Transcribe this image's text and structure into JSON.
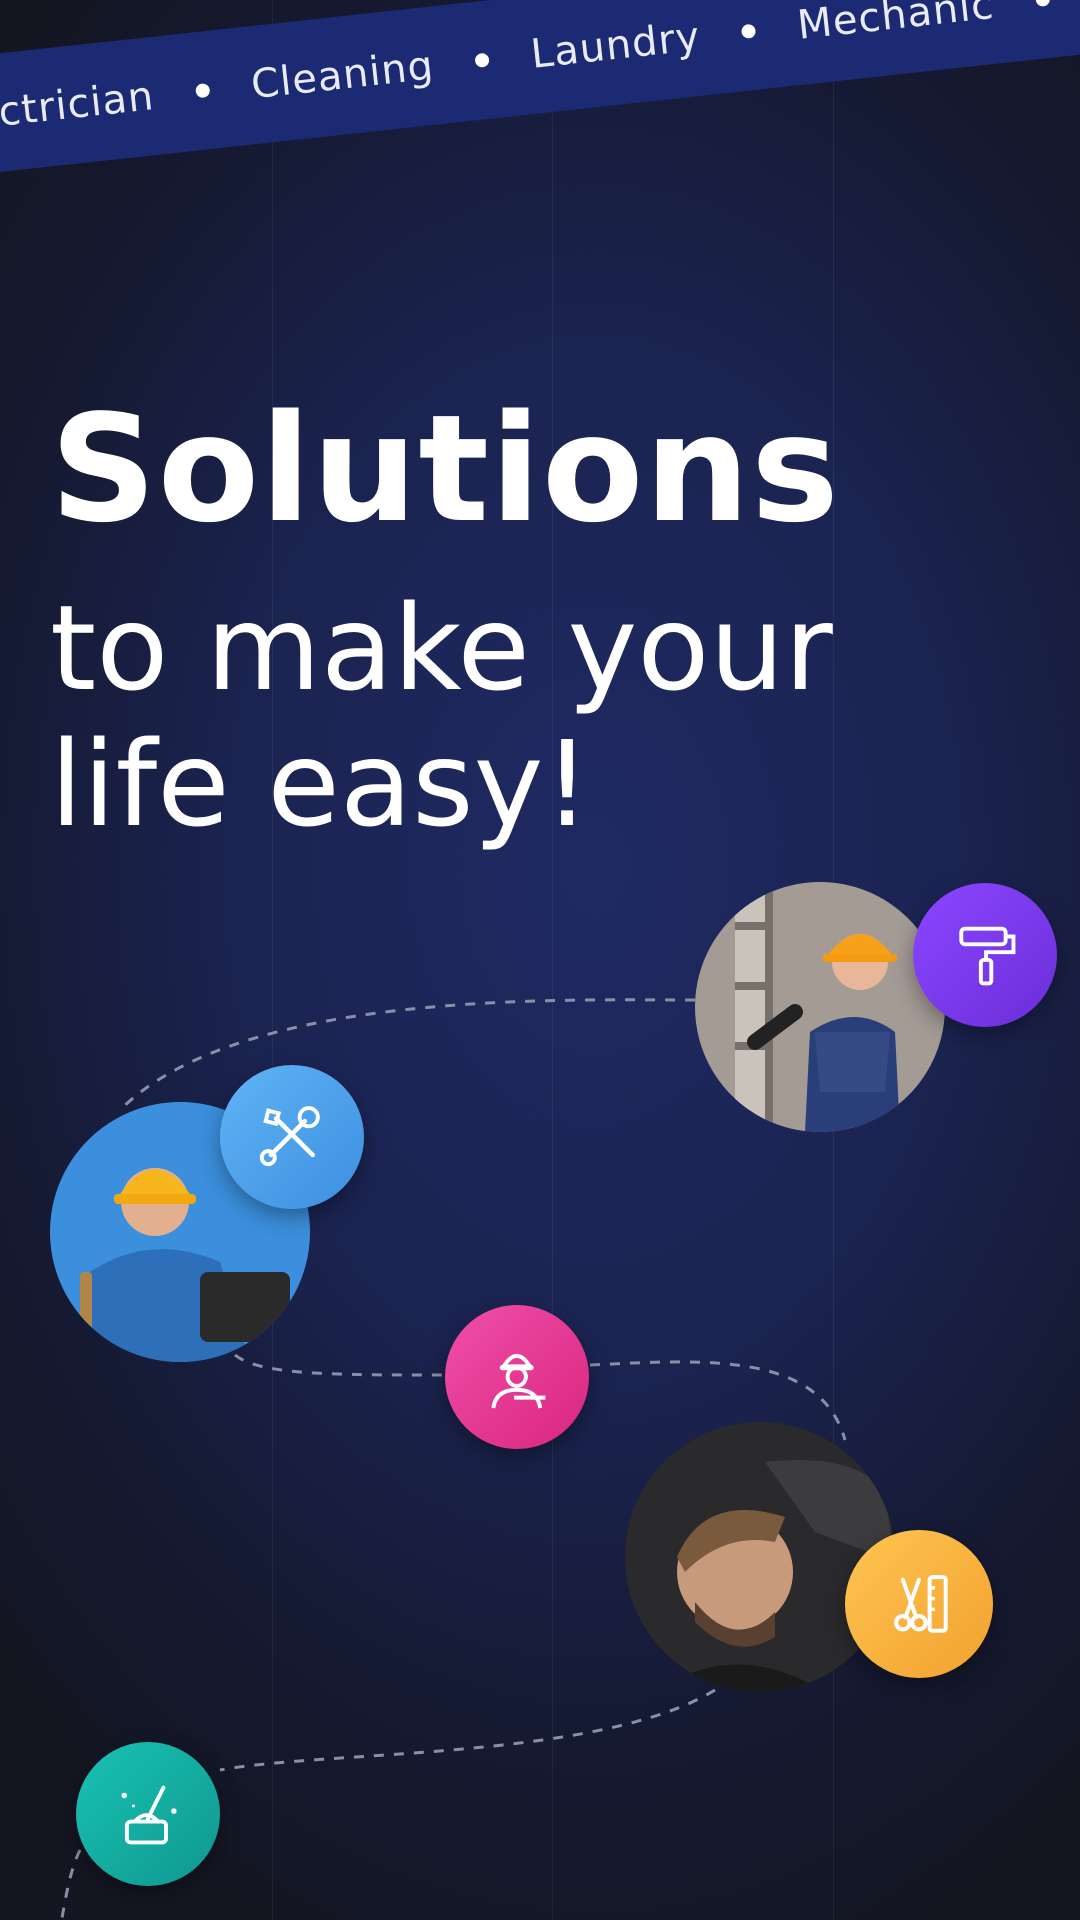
{
  "ribbon": {
    "items": [
      "lectrician",
      "Cleaning",
      "Laundry",
      "Mechanic"
    ]
  },
  "headline": {
    "title": "Solutions",
    "line1": "to make your",
    "line2": "life easy!"
  },
  "services": [
    {
      "icon": "paint-roller-icon",
      "color": "#7b3cf0"
    },
    {
      "icon": "tools-icon",
      "color": "#4ea3ee"
    },
    {
      "icon": "worker-icon",
      "color": "#ea3b9b"
    },
    {
      "icon": "barber-icon",
      "color": "#f7b33b"
    },
    {
      "icon": "cleaning-icon",
      "color": "#14b3a8"
    }
  ],
  "colors": {
    "background": "#151a33",
    "ribbon": "#1c2a73"
  }
}
